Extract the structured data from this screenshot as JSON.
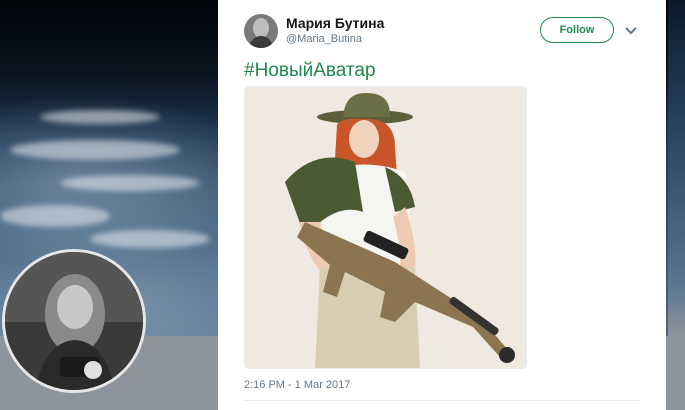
{
  "tweet": {
    "author_name": "Мария Бутина",
    "author_handle": "@Maria_Butina",
    "follow_label": "Follow",
    "hashtag": "#НовыйАватар",
    "timestamp": "2:16 PM - 1 Mar 2017"
  },
  "icons": {
    "menu": "chevron-down-icon"
  },
  "colors": {
    "accent": "#1f8a4c",
    "text_primary": "#14171a",
    "text_secondary": "#657786"
  }
}
